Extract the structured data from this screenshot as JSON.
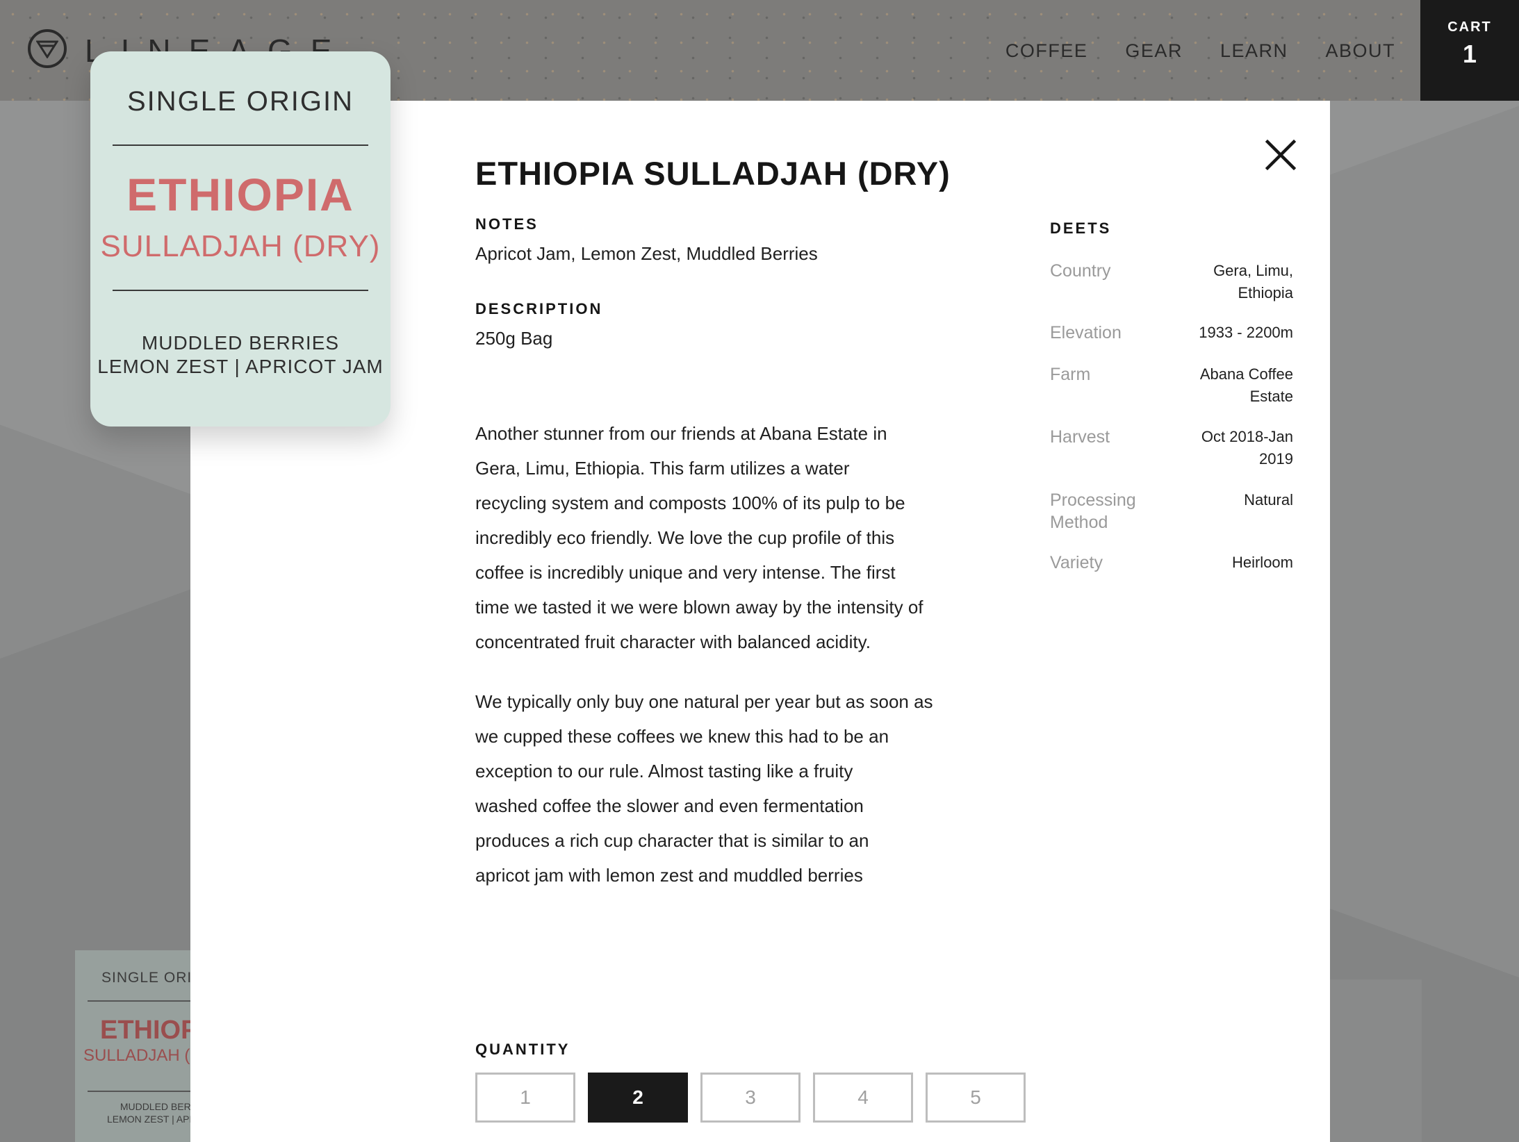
{
  "site": {
    "logo_text": "LINEAGE",
    "nav": [
      "COFFEE",
      "GEAR",
      "LEARN",
      "ABOUT"
    ],
    "cart_label": "CART",
    "cart_count": "1"
  },
  "background_card": {
    "type": "SINGLE ORIG",
    "origin": "ETHIOPI",
    "sub": "SULLADJAH (",
    "notes_line1": "MUDDLED BERRI",
    "notes_line2": "LEMON ZEST | APRICO"
  },
  "label_card": {
    "type": "SINGLE ORIGIN",
    "origin": "ETHIOPIA",
    "sub": "SULLADJAH (DRY)",
    "notes_line1": "MUDDLED BERRIES",
    "notes_line2": "LEMON ZEST | APRICOT JAM"
  },
  "product": {
    "title": "ETHIOPIA SULLADJAH (DRY)",
    "notes_heading": "NOTES",
    "notes": "Apricot Jam, Lemon Zest, Muddled Berries",
    "description_heading": "DESCRIPTION",
    "description": "250g Bag",
    "paragraph1_lines": [
      "Another stunner from our friends at Abana Estate in",
      "Gera, Limu, Ethiopia.  This farm utilizes a water",
      "recycling system and composts 100% of its pulp to be",
      "incredibly eco friendly.  We love the cup profile of this",
      "coffee is incredibly unique and very intense. The first",
      "time we tasted it we were blown away by the intensity of",
      "concentrated fruit character with balanced acidity."
    ],
    "paragraph2_lines": [
      "We typically only buy one natural per year but as soon as",
      "we cupped these coffees we knew this had to be an",
      "exception to our rule.  Almost tasting like a fruity",
      "washed coffee the slower and even fermentation",
      "produces a rich cup character that is similar to an",
      "apricot jam with lemon zest and muddled berries"
    ]
  },
  "deets": {
    "heading": "DEETS",
    "rows": [
      {
        "key": "Country",
        "val1": "Gera, Limu,",
        "val2": "Ethiopia"
      },
      {
        "key": "Elevation",
        "val1": "1933 - 2200m",
        "val2": ""
      },
      {
        "key": "Farm",
        "val1": "Abana Coffee",
        "val2": "Estate"
      },
      {
        "key": "Harvest",
        "val1": "Oct 2018-Jan",
        "val2": "2019"
      },
      {
        "key": "Processing",
        "key2": "Method",
        "val1": "Natural",
        "val2": ""
      },
      {
        "key": "Variety",
        "val1": "Heirloom",
        "val2": ""
      }
    ]
  },
  "quantity": {
    "heading": "QUANTITY",
    "options": [
      "1",
      "2",
      "3",
      "4",
      "5"
    ],
    "selected": "2"
  },
  "colors": {
    "accent": "#cf6b6c",
    "card_bg": "#d6e6e0",
    "selected_bg": "#1a1a1a"
  },
  "icons": {
    "close": "close-icon",
    "logo": "lineage-logo-icon"
  }
}
